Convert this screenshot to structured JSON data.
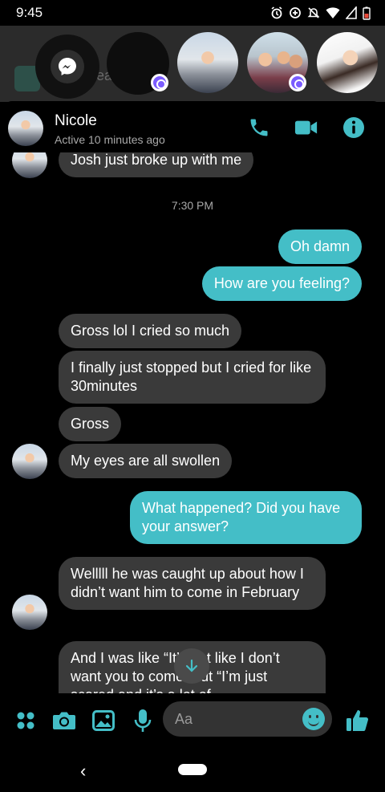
{
  "status_bar": {
    "time": "9:45"
  },
  "chat_heads": {
    "background_text": "ea"
  },
  "header": {
    "name": "Nicole",
    "status": "Active 10 minutes ago"
  },
  "messages": {
    "m0": "Josh just broke up with me",
    "timestamp": "7:30 PM",
    "m1": "Oh damn",
    "m2": "How are you feeling?",
    "m3": "Gross lol I cried so much",
    "m4": "I finally just stopped but I cried for like 30minutes",
    "m5": "Gross",
    "m6": "My eyes are all swollen",
    "m7": "What happened? Did you have your answer?",
    "m8": "Welllll he was caught up about how I didn’t want him to come in February",
    "m9": "And I was like “It’s not like I don’t want you to come” but “I’m just scared and it’s a lot of"
  },
  "composer": {
    "placeholder": "Aa"
  },
  "colors": {
    "accent": "#44bec7",
    "incoming_bubble": "#3a3a3a",
    "background": "#000000"
  }
}
